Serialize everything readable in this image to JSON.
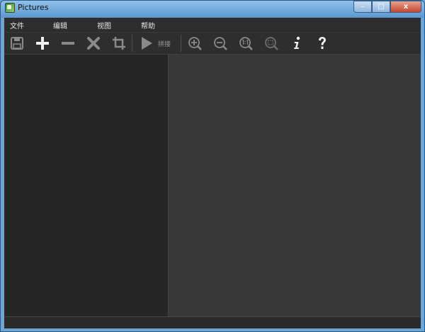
{
  "window": {
    "title": "Pictures"
  },
  "caption": {
    "minimize": "–",
    "maximize": "□",
    "close": "x"
  },
  "menu": {
    "items": [
      "文件",
      "编辑",
      "视图",
      "帮助"
    ]
  },
  "toolbar": {
    "buttons": [
      "save-icon",
      "add-icon",
      "remove-icon",
      "delete-icon",
      "crop-icon",
      "play-icon",
      "zoom-in-icon",
      "zoom-out-icon",
      "zoom-actual-icon",
      "zoom-fit-icon",
      "info-icon",
      "help-icon"
    ],
    "stitch_label": "拼接"
  },
  "colors": {
    "panel_left": "#262626",
    "panel_right": "#383838",
    "icon_bright": "#f2f2f2",
    "icon_dim": "#8a8a8a"
  }
}
